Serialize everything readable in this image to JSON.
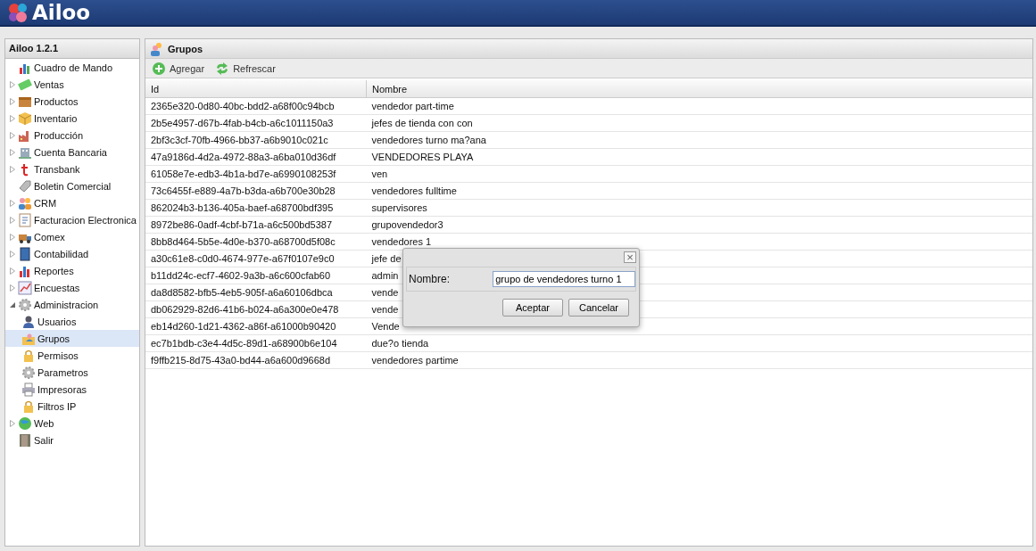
{
  "app": {
    "logo": "Ailoo"
  },
  "sidebar": {
    "title": "Ailoo 1.2.1",
    "items": [
      {
        "label": "Cuadro de Mando",
        "selected": false
      },
      {
        "label": "Ventas",
        "selected": false,
        "expanded": false
      },
      {
        "label": "Productos",
        "selected": false,
        "expanded": false
      },
      {
        "label": "Inventario",
        "selected": false,
        "expanded": false
      },
      {
        "label": "Producción",
        "selected": false,
        "expanded": false
      },
      {
        "label": "Cuenta Bancaria",
        "selected": false,
        "expanded": false
      },
      {
        "label": "Transbank",
        "selected": false,
        "expanded": false
      },
      {
        "label": "Boletin Comercial",
        "selected": false
      },
      {
        "label": "CRM",
        "selected": false,
        "expanded": false
      },
      {
        "label": "Facturacion Electronica",
        "selected": false,
        "expanded": false
      },
      {
        "label": "Comex",
        "selected": false,
        "expanded": false
      },
      {
        "label": "Contabilidad",
        "selected": false,
        "expanded": false
      },
      {
        "label": "Reportes",
        "selected": false,
        "expanded": false
      },
      {
        "label": "Encuestas",
        "selected": false,
        "expanded": false
      },
      {
        "label": "Administracion",
        "selected": false,
        "expanded": true,
        "children": [
          {
            "label": "Usuarios",
            "selected": false
          },
          {
            "label": "Grupos",
            "selected": true
          },
          {
            "label": "Permisos",
            "selected": false
          },
          {
            "label": "Parametros",
            "selected": false
          },
          {
            "label": "Impresoras",
            "selected": false
          },
          {
            "label": "Filtros IP",
            "selected": false
          }
        ]
      },
      {
        "label": "Web",
        "selected": false,
        "expanded": false
      },
      {
        "label": "Salir",
        "selected": false
      }
    ]
  },
  "panel": {
    "title": "Grupos",
    "toolbar": [
      "Agregar",
      "Refrescar"
    ]
  },
  "table": {
    "columns": [
      "Id",
      "Nombre"
    ],
    "rows": [
      [
        "2365e320-0d80-40bc-bdd2-a68f00c94bcb",
        "vendedor part-time"
      ],
      [
        "2b5e4957-d67b-4fab-b4cb-a6c1011150a3",
        "jefes de tienda con con"
      ],
      [
        "2bf3c3cf-70fb-4966-bb37-a6b9010c021c",
        "vendedores turno ma?ana"
      ],
      [
        "47a9186d-4d2a-4972-88a3-a6ba010d36df",
        "VENDEDORES PLAYA"
      ],
      [
        "61058e7e-edb3-4b1a-bd7e-a6990108253f",
        "ven"
      ],
      [
        "73c6455f-e889-4a7b-b3da-a6b700e30b28",
        "vendedores fulltime"
      ],
      [
        "862024b3-b136-405a-baef-a68700bdf395",
        "supervisores"
      ],
      [
        "8972be86-0adf-4cbf-b71a-a6c500bd5387",
        "grupovendedor3"
      ],
      [
        "8bb8d464-5b5e-4d0e-b370-a68700d5f08c",
        "vendedores 1"
      ],
      [
        "a30c61e8-c0d0-4674-977e-a67f0107e9c0",
        "jefe de"
      ],
      [
        "b11dd24c-ecf7-4602-9a3b-a6c600cfab60",
        "admin"
      ],
      [
        "da8d8582-bfb5-4eb5-905f-a6a60106dbca",
        "vende"
      ],
      [
        "db062929-82d6-41b6-b024-a6a300e0e478",
        "vende"
      ],
      [
        "eb14d260-1d21-4362-a86f-a61000b90420",
        "Vende"
      ],
      [
        "ec7b1bdb-c3e4-4d5c-89d1-a68900b6e104",
        "due?o tienda"
      ],
      [
        "f9ffb215-8d75-43a0-bd44-a6a600d9668d",
        "vendedores partime"
      ]
    ]
  },
  "dialog": {
    "close": "×",
    "label": "Nombre:",
    "value": "grupo de vendedores turno 1",
    "buttons": [
      "Aceptar",
      "Cancelar"
    ]
  }
}
